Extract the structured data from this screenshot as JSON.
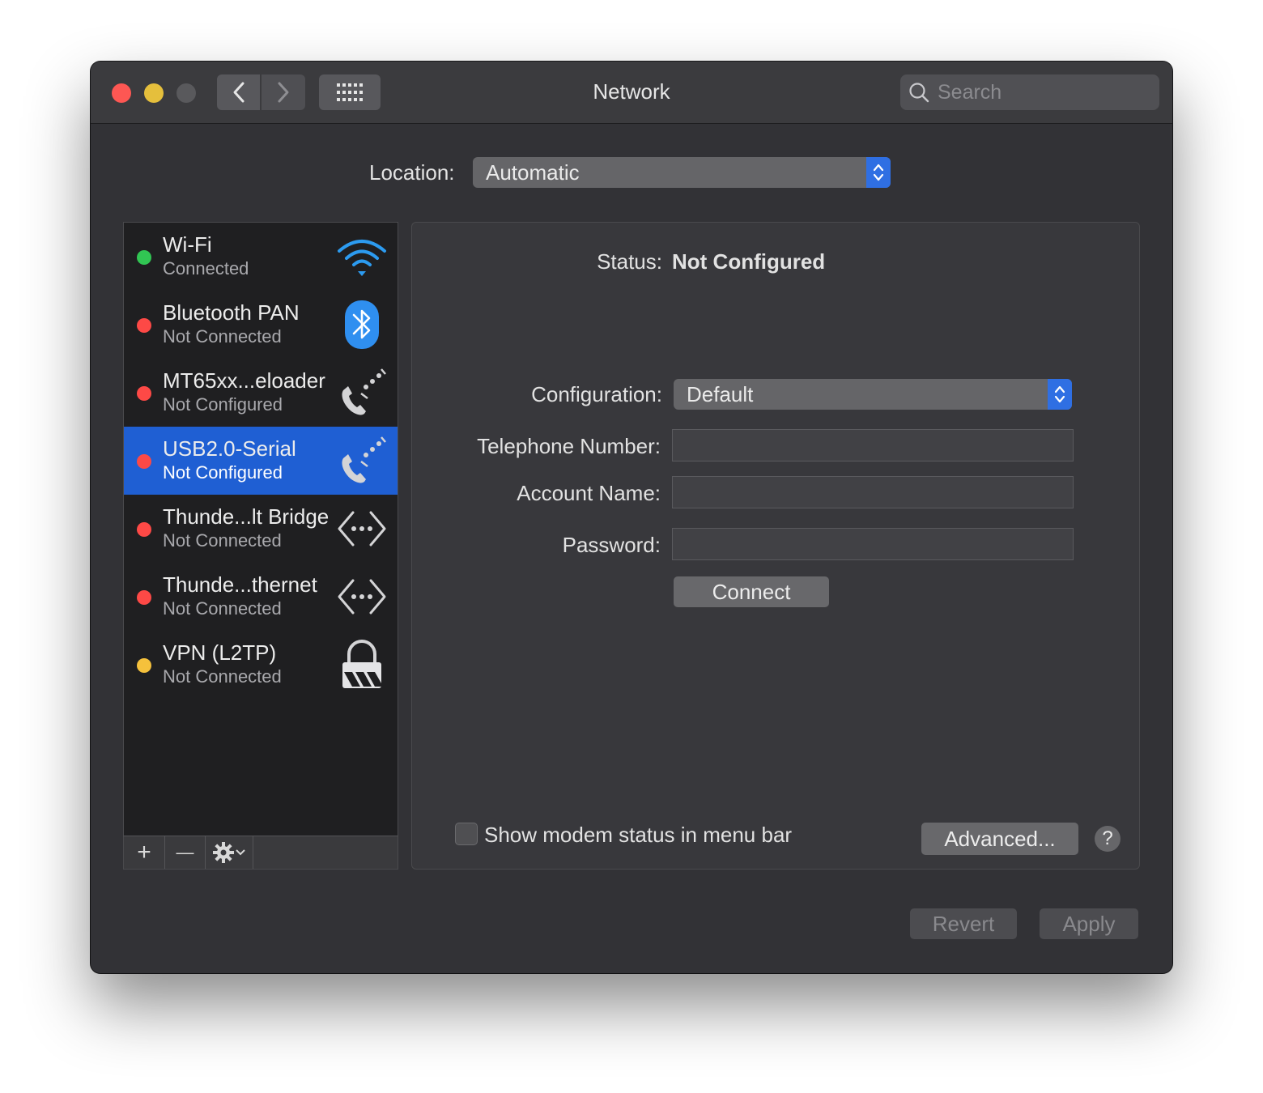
{
  "window": {
    "title": "Network"
  },
  "search": {
    "placeholder": "Search"
  },
  "location": {
    "label": "Location:",
    "value": "Automatic"
  },
  "services": [
    {
      "name": "Wi-Fi",
      "status": "Connected",
      "dot_color": "#31c553",
      "icon": "wifi-icon"
    },
    {
      "name": "Bluetooth PAN",
      "status": "Not Connected",
      "dot_color": "#fd4946",
      "icon": "bluetooth-icon"
    },
    {
      "name": "MT65xx...eloader",
      "status": "Not Configured",
      "dot_color": "#fd4946",
      "icon": "modem-phone-icon"
    },
    {
      "name": "USB2.0-Serial",
      "status": "Not Configured",
      "dot_color": "#fd4946",
      "icon": "modem-phone-icon",
      "selected": true
    },
    {
      "name": "Thunde...lt Bridge",
      "status": "Not Connected",
      "dot_color": "#fd4946",
      "icon": "ethernet-arrows-icon"
    },
    {
      "name": "Thunde...thernet",
      "status": "Not Connected",
      "dot_color": "#fd4946",
      "icon": "ethernet-arrows-icon"
    },
    {
      "name": "VPN (L2TP)",
      "status": "Not Connected",
      "dot_color": "#f5c13c",
      "icon": "vpn-lock-icon"
    }
  ],
  "toolbar": {
    "add": "+",
    "remove": "—"
  },
  "detail": {
    "status_label": "Status:",
    "status_value": "Not Configured",
    "configuration_label": "Configuration:",
    "configuration_value": "Default",
    "telephone_label": "Telephone Number:",
    "telephone_value": "",
    "account_label": "Account Name:",
    "account_value": "",
    "password_label": "Password:",
    "password_value": "",
    "connect_label": "Connect",
    "show_modem_label": "Show modem status in menu bar",
    "show_modem_checked": false,
    "advanced_label": "Advanced...",
    "help_label": "?"
  },
  "footer": {
    "revert_label": "Revert",
    "apply_label": "Apply"
  },
  "colors": {
    "accent": "#1f5fd3",
    "popup_arrows": "#2f6fe3"
  }
}
